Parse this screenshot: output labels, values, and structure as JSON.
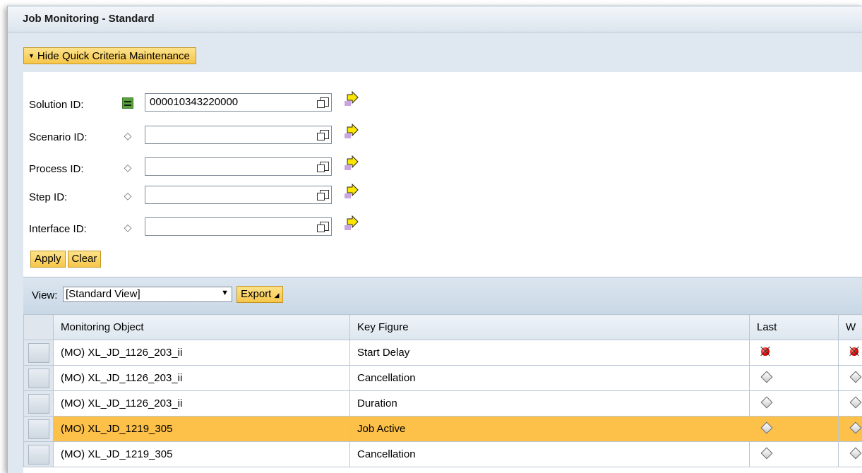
{
  "window": {
    "title": "Job Monitoring - Standard"
  },
  "criteria": {
    "toggle_label": "Hide Quick Criteria Maintenance",
    "fields": [
      {
        "label": "Solution ID:",
        "value": "000010343220000"
      },
      {
        "label": "Scenario ID:",
        "value": ""
      },
      {
        "label": "Process ID:",
        "value": ""
      },
      {
        "label": "Step ID:",
        "value": ""
      },
      {
        "label": "Interface ID:",
        "value": ""
      }
    ],
    "apply_label": "Apply",
    "clear_label": "Clear"
  },
  "toolbar": {
    "view_label": "View:",
    "view_value": "[Standard View]",
    "export_label": "Export"
  },
  "grid": {
    "columns": [
      "Monitoring Object",
      "Key Figure",
      "Last",
      "W"
    ],
    "rows": [
      {
        "object": "(MO) XL_JD_1126_203_ii",
        "key_figure": "Start Delay",
        "last": "red-alert-icon",
        "w": "red-alert-icon",
        "highlight": false
      },
      {
        "object": "(MO) XL_JD_1126_203_ii",
        "key_figure": "Cancellation",
        "last": "gray-diamond-icon",
        "w": "gray-diamond-icon",
        "highlight": false
      },
      {
        "object": "(MO) XL_JD_1126_203_ii",
        "key_figure": "Duration",
        "last": "gray-diamond-icon",
        "w": "gray-diamond-icon",
        "highlight": false
      },
      {
        "object": "(MO) XL_JD_1219_305",
        "key_figure": "Job Active",
        "last": "gray-diamond-icon",
        "w": "gray-diamond-icon",
        "highlight": true
      },
      {
        "object": "(MO) XL_JD_1219_305",
        "key_figure": "Cancellation",
        "last": "gray-diamond-icon",
        "w": "gray-diamond-icon",
        "highlight": false
      }
    ]
  },
  "colors": {
    "accent_yellow": "#f6c64a",
    "highlight_row": "#fdc048",
    "panel_blue": "#dfe8f1"
  }
}
